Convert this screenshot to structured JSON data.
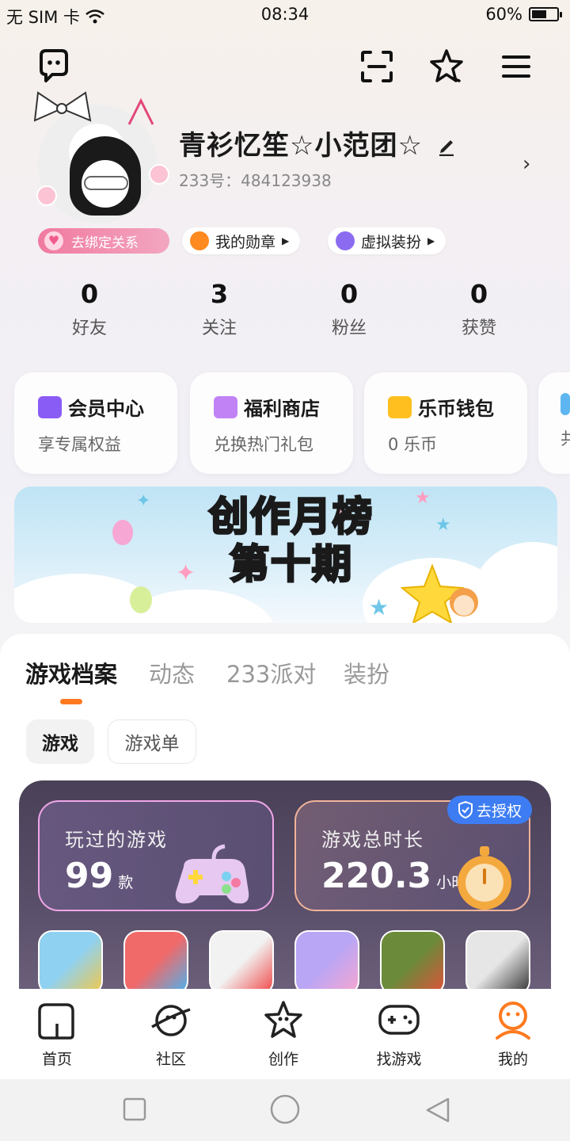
{
  "status_bar": {
    "carrier": "无 SIM 卡",
    "time": "08:34",
    "battery": "60%",
    "battery_level": 0.6
  },
  "top_bar": {
    "icons": [
      "message-bubble-icon",
      "scan-icon",
      "star-badge-icon",
      "menu-icon"
    ]
  },
  "profile": {
    "nickname": "青衫忆笙☆小范团☆",
    "uid": "233号：484123938",
    "bind_label": "去绑定关系",
    "chips": [
      {
        "label": "我的勋章",
        "color": "#ff8a1f"
      },
      {
        "label": "虚拟装扮",
        "color": "#8b6cf0"
      }
    ]
  },
  "stats": [
    {
      "value": "0",
      "label": "好友"
    },
    {
      "value": "3",
      "label": "关注"
    },
    {
      "value": "0",
      "label": "粉丝"
    },
    {
      "value": "0",
      "label": "获赞"
    }
  ],
  "cards": [
    {
      "title": "会员中心",
      "subtitle": "享专属权益",
      "icon_color": "#8a5cf6"
    },
    {
      "title": "福利商店",
      "subtitle": "兑换热门礼包",
      "icon_color": "#c082f5"
    },
    {
      "title": "乐币钱包",
      "subtitle": "0 乐币",
      "icon_color": "#ffbf1f"
    },
    {
      "title": "",
      "subtitle": "共",
      "icon_color": "#5db6f0"
    }
  ],
  "banner": {
    "line1": "创作月榜",
    "line2": "第十期"
  },
  "tabs": [
    "游戏档案",
    "动态",
    "233派对",
    "装扮"
  ],
  "subtabs": [
    "游戏",
    "游戏单"
  ],
  "game_stats": {
    "played_label": "玩过的游戏",
    "played_value": "99",
    "played_unit": "款",
    "duration_label": "游戏总时长",
    "duration_value": "220.3",
    "duration_unit": "小时",
    "auth_label": "去授权"
  },
  "game_icons": [
    {
      "name": "game-1",
      "colors": [
        "#8fd1f0",
        "#f3c84a"
      ]
    },
    {
      "name": "game-2",
      "colors": [
        "#f06a6a",
        "#4ab3f0"
      ]
    },
    {
      "name": "game-3",
      "colors": [
        "#f2f2f2",
        "#f04646"
      ]
    },
    {
      "name": "game-4",
      "colors": [
        "#b9a6f5",
        "#f7a6d0"
      ]
    },
    {
      "name": "game-5",
      "colors": [
        "#6b8a3a",
        "#e0523a"
      ]
    },
    {
      "name": "game-6",
      "colors": [
        "#e6e6e6",
        "#333333"
      ]
    }
  ],
  "bottom_nav": [
    {
      "label": "首页",
      "icon": "home-icon"
    },
    {
      "label": "社区",
      "icon": "planet-icon"
    },
    {
      "label": "创作",
      "icon": "create-star-icon"
    },
    {
      "label": "找游戏",
      "icon": "gamepad-icon"
    },
    {
      "label": "我的",
      "icon": "profile-face-icon"
    }
  ]
}
